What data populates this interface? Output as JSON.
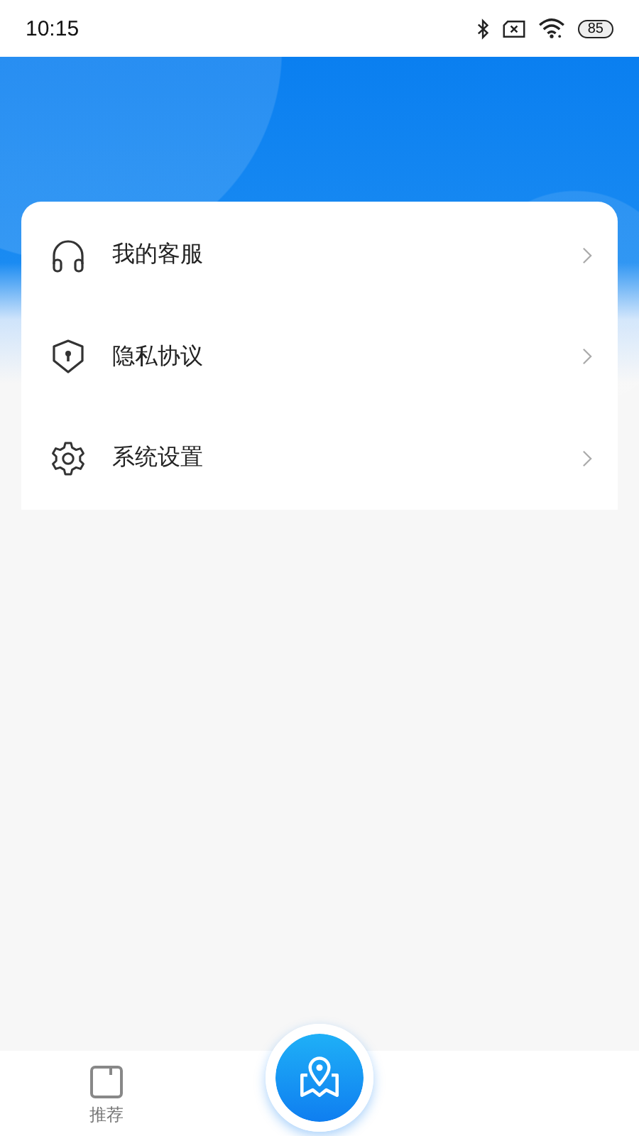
{
  "status_bar": {
    "time": "10:15",
    "battery": "85"
  },
  "menu_items": [
    {
      "label": "我的客服",
      "kind": "headset"
    },
    {
      "label": "隐私协议",
      "kind": "shield"
    },
    {
      "label": "系统设置",
      "kind": "gear"
    }
  ],
  "tab_bar": {
    "tabs": [
      {
        "label": "推荐",
        "kind": "square"
      }
    ]
  }
}
